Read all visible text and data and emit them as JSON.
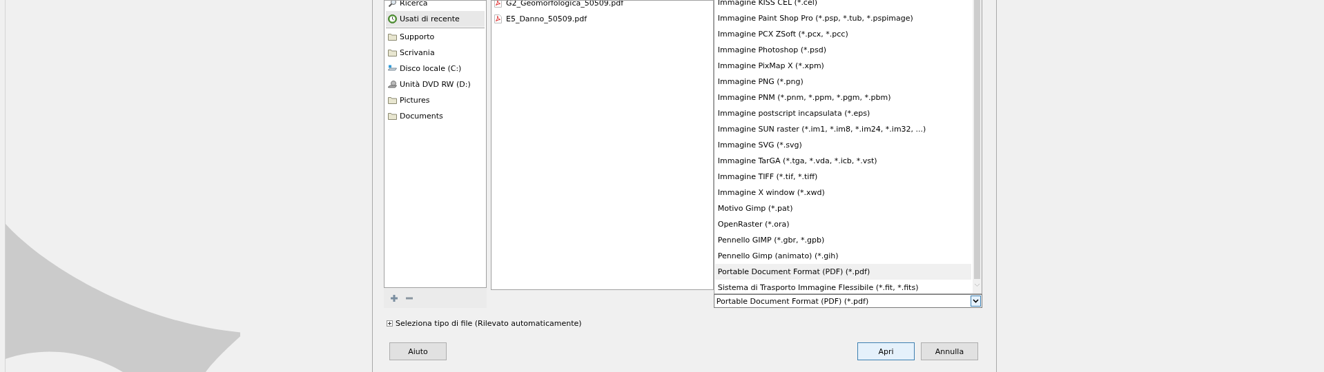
{
  "sidebar": {
    "top_items": [
      {
        "label": "Ricerca",
        "kind": "search",
        "selected": false
      },
      {
        "label": "Usati di recente",
        "kind": "recent",
        "selected": true
      }
    ],
    "places": [
      {
        "label": "Supporto",
        "kind": "folder",
        "selected": false
      },
      {
        "label": "Scrivania",
        "kind": "folder",
        "selected": false
      },
      {
        "label": "Disco locale (C:)",
        "kind": "drive",
        "selected": false
      },
      {
        "label": "Unità DVD RW (D:)",
        "kind": "dvd",
        "selected": false
      },
      {
        "label": "Pictures",
        "kind": "folder",
        "selected": false
      },
      {
        "label": "Documents",
        "kind": "folder",
        "selected": false
      }
    ]
  },
  "files": [
    {
      "name": "G2_Geomorfologica_50509.pdf"
    },
    {
      "name": "E5_Danno_50509.pdf"
    }
  ],
  "file_type_list": [
    {
      "label": "Immagine KISS CEL (*.cel)",
      "selected": false
    },
    {
      "label": "Immagine Paint Shop Pro (*.psp, *.tub, *.pspimage)",
      "selected": false
    },
    {
      "label": "Immagine PCX ZSoft (*.pcx, *.pcc)",
      "selected": false
    },
    {
      "label": "Immagine Photoshop (*.psd)",
      "selected": false
    },
    {
      "label": "Immagine PixMap X (*.xpm)",
      "selected": false
    },
    {
      "label": "Immagine PNG (*.png)",
      "selected": false
    },
    {
      "label": "Immagine PNM (*.pnm, *.ppm, *.pgm, *.pbm)",
      "selected": false
    },
    {
      "label": "Immagine postscript incapsulata (*.eps)",
      "selected": false
    },
    {
      "label": "Immagine SUN raster (*.im1, *.im8, *.im24, *.im32, ...)",
      "selected": false
    },
    {
      "label": "Immagine SVG (*.svg)",
      "selected": false
    },
    {
      "label": "Immagine TarGA (*.tga, *.vda, *.icb, *.vst)",
      "selected": false
    },
    {
      "label": "Immagine TIFF (*.tif, *.tiff)",
      "selected": false
    },
    {
      "label": "Immagine X window (*.xwd)",
      "selected": false
    },
    {
      "label": "Motivo Gimp (*.pat)",
      "selected": false
    },
    {
      "label": "OpenRaster (*.ora)",
      "selected": false
    },
    {
      "label": "Pennello GIMP (*.gbr, *.gpb)",
      "selected": false
    },
    {
      "label": "Pennello Gimp (animato) (*.gih)",
      "selected": false
    },
    {
      "label": "Portable Document Format (PDF) (*.pdf)",
      "selected": true
    },
    {
      "label": "Sistema di Trasporto Immagine Flessibile (*.fit, *.fits)",
      "selected": false
    }
  ],
  "file_type_combo": {
    "value": "Portable Document Format (PDF) (*.pdf)"
  },
  "expander": {
    "label": "Seleziona tipo di file (Rilevato automaticamente)",
    "expanded": false
  },
  "buttons_left": [
    {
      "label": "Aiuto",
      "default": false
    }
  ],
  "buttons_right": [
    {
      "label": "Apri",
      "default": true
    },
    {
      "label": "Annulla",
      "default": false
    }
  ]
}
